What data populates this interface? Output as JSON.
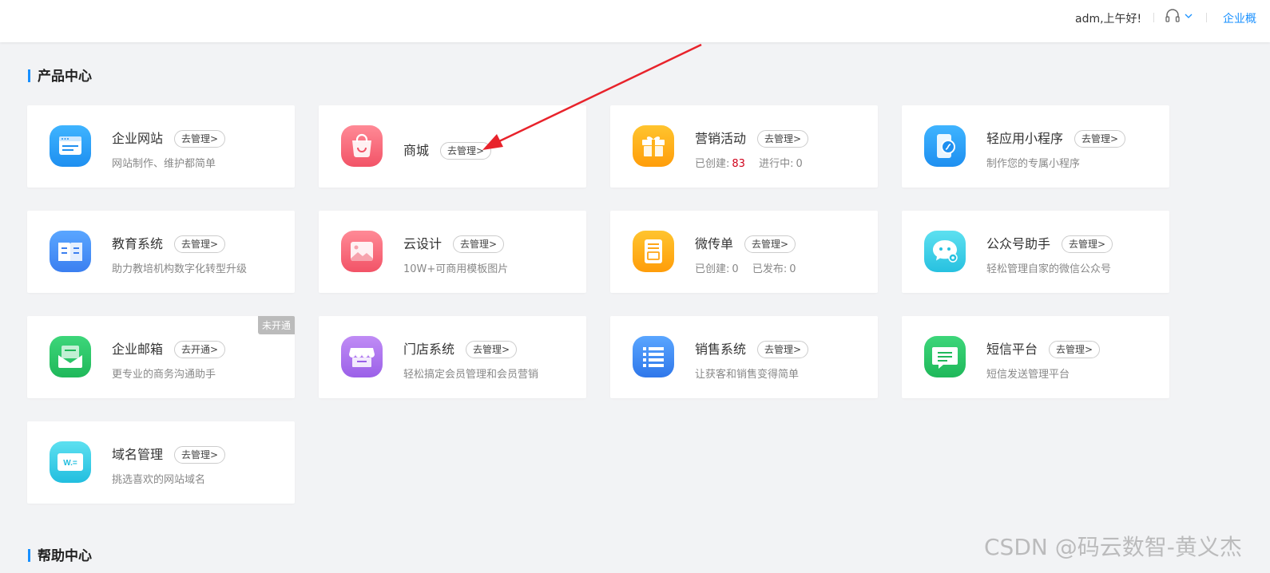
{
  "header": {
    "greeting": "adm,上午好!",
    "company_link": "企业概"
  },
  "sections": {
    "product_center": "产品中心",
    "help_center": "帮助中心"
  },
  "products": [
    {
      "name": "企业网站",
      "button": "去管理>",
      "desc": "网站制作、维护都简单",
      "icon": "website-icon"
    },
    {
      "name": "商城",
      "button": "去管理>",
      "desc": "",
      "icon": "shopping-bag-icon"
    },
    {
      "name": "营销活动",
      "button": "去管理>",
      "stats": [
        {
          "label": "已创建:",
          "value": "83"
        },
        {
          "label": "进行中:",
          "value": "0"
        }
      ],
      "icon": "gift-icon"
    },
    {
      "name": "轻应用小程序",
      "button": "去管理>",
      "desc": "制作您的专属小程序",
      "icon": "mini-program-icon"
    },
    {
      "name": "教育系统",
      "button": "去管理>",
      "desc": "助力教培机构数字化转型升级",
      "icon": "book-icon"
    },
    {
      "name": "云设计",
      "button": "去管理>",
      "desc": "10W+可商用模板图片",
      "icon": "image-icon"
    },
    {
      "name": "微传单",
      "button": "去管理>",
      "stats": [
        {
          "label": "已创建:",
          "value": "0"
        },
        {
          "label": "已发布:",
          "value": "0"
        }
      ],
      "icon": "flyer-icon"
    },
    {
      "name": "公众号助手",
      "button": "去管理>",
      "desc": "轻松管理自家的微信公众号",
      "icon": "wechat-icon"
    },
    {
      "name": "企业邮箱",
      "button": "去开通>",
      "desc": "更专业的商务沟通助手",
      "badge": "未开通",
      "icon": "mail-icon"
    },
    {
      "name": "门店系统",
      "button": "去管理>",
      "desc": "轻松搞定会员管理和会员营销",
      "icon": "store-icon"
    },
    {
      "name": "销售系统",
      "button": "去管理>",
      "desc": "让获客和销售变得简单",
      "icon": "list-icon"
    },
    {
      "name": "短信平台",
      "button": "去管理>",
      "desc": "短信发送管理平台",
      "icon": "sms-icon"
    },
    {
      "name": "域名管理",
      "button": "去管理>",
      "desc": "挑选喜欢的网站域名",
      "icon": "domain-icon"
    }
  ],
  "watermark": "CSDN @码云数智-黄义杰",
  "colors": {
    "accent": "#1890ff",
    "highlight": "#d0021b",
    "arrow": "#e8232b"
  }
}
